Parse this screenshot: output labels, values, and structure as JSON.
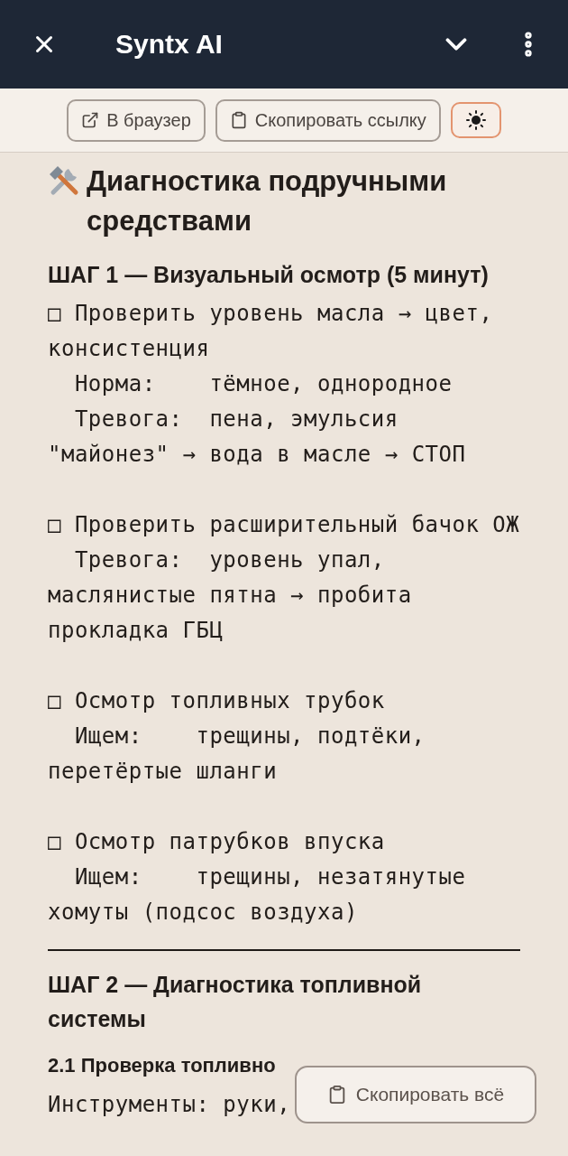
{
  "app_bar": {
    "title": "Syntx AI"
  },
  "toolbar": {
    "buttons": [
      {
        "kind": "external",
        "label": "В браузер"
      },
      {
        "kind": "copy",
        "label": "Скопировать ссылку"
      },
      {
        "kind": "theme"
      }
    ]
  },
  "content": {
    "title": "Диагностика подручными средствами",
    "blocks": [
      {
        "kind": "step",
        "text": "ШАГ 1 — Визуальный осмотр (5 минут)"
      },
      {
        "kind": "checklist",
        "items": [
          {
            "task": "□ Проверить уровень масла → цвет, консистенция",
            "notes": [
              "Норма:    тёмное, однородное",
              "Тревога:  пена, эмульсия \"майонез\" → вода в масле → СТОП"
            ]
          },
          {
            "task": "□ Проверить расширительный бачок ОЖ",
            "notes": [
              "Тревога:  уровень упал, маслянистые пятна → пробита прокладка ГБЦ"
            ]
          },
          {
            "task": "□ Осмотр топливных трубок",
            "notes": [
              "Ищем:    трещины, подтёки, перетёртые шланги"
            ]
          },
          {
            "task": "□ Осмотр патрубков впуска",
            "notes": [
              "Ищем:    трещины, незатянутые хомуты (подсос воздуха)"
            ]
          }
        ]
      },
      {
        "kind": "rule"
      },
      {
        "kind": "step",
        "text": "ШАГ 2 — Диагностика топливной системы"
      },
      {
        "kind": "substep",
        "text": "2.1 Проверка топливно"
      },
      {
        "kind": "text",
        "text": "Инструменты: руки,"
      }
    ]
  },
  "floating_button": {
    "label": "Скопировать всё"
  }
}
